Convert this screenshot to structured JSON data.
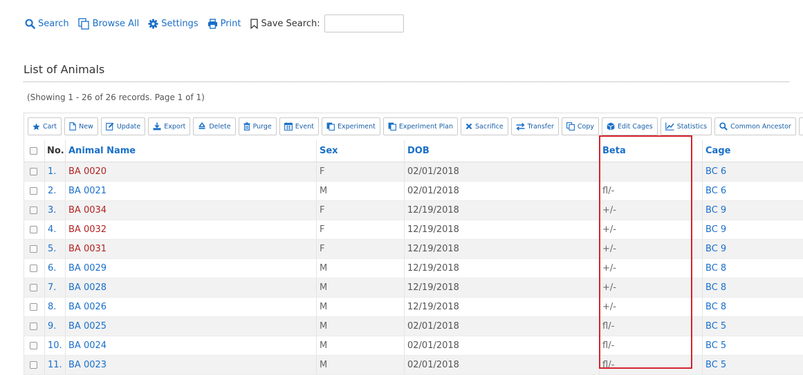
{
  "nav": {
    "search": "Search",
    "browse_all": "Browse All",
    "settings": "Settings",
    "print": "Print",
    "save_search": "Save Search:",
    "save_search_value": ""
  },
  "heading": "List of Animals",
  "showing": "(Showing 1 - 26 of 26 records. Page 1 of 1)",
  "toolbar": [
    {
      "label": "Cart",
      "icon": "star-icon"
    },
    {
      "label": "New",
      "icon": "file-icon"
    },
    {
      "label": "Update",
      "icon": "edit-icon"
    },
    {
      "label": "Export",
      "icon": "download-icon"
    },
    {
      "label": "Delete",
      "icon": "recycle-icon"
    },
    {
      "label": "Purge",
      "icon": "trash-icon"
    },
    {
      "label": "Event",
      "icon": "calendar-icon"
    },
    {
      "label": "Experiment",
      "icon": "clipboard-icon"
    },
    {
      "label": "Experiment Plan",
      "icon": "clipboard-icon"
    },
    {
      "label": "Sacrifice",
      "icon": "x-icon"
    },
    {
      "label": "Transfer",
      "icon": "transfer-icon"
    },
    {
      "label": "Copy",
      "icon": "copy-icon"
    },
    {
      "label": "Edit Cages",
      "icon": "cube-icon"
    },
    {
      "label": "Statistics",
      "icon": "chart-icon"
    },
    {
      "label": "Common Ancestor",
      "icon": "search-icon"
    },
    {
      "label": "",
      "icon": "scale-icon"
    }
  ],
  "columns": {
    "no": "No.",
    "name": "Animal Name",
    "sex": "Sex",
    "dob": "DOB",
    "beta": "Beta",
    "cage": "Cage"
  },
  "rows": [
    {
      "no": "1.",
      "name": "BA 0020",
      "sex": "F",
      "dob": "02/01/2018",
      "beta": "",
      "cage": "BC 6",
      "female": true
    },
    {
      "no": "2.",
      "name": "BA 0021",
      "sex": "M",
      "dob": "02/01/2018",
      "beta": "fl/-",
      "cage": "BC 6",
      "female": false
    },
    {
      "no": "3.",
      "name": "BA 0034",
      "sex": "F",
      "dob": "12/19/2018",
      "beta": "+/-",
      "cage": "BC 9",
      "female": true
    },
    {
      "no": "4.",
      "name": "BA 0032",
      "sex": "F",
      "dob": "12/19/2018",
      "beta": "+/-",
      "cage": "BC 9",
      "female": true
    },
    {
      "no": "5.",
      "name": "BA 0031",
      "sex": "F",
      "dob": "12/19/2018",
      "beta": "+/-",
      "cage": "BC 9",
      "female": true
    },
    {
      "no": "6.",
      "name": "BA 0029",
      "sex": "M",
      "dob": "12/19/2018",
      "beta": "+/-",
      "cage": "BC 8",
      "female": false
    },
    {
      "no": "7.",
      "name": "BA 0028",
      "sex": "M",
      "dob": "12/19/2018",
      "beta": "+/-",
      "cage": "BC 8",
      "female": false
    },
    {
      "no": "8.",
      "name": "BA 0026",
      "sex": "M",
      "dob": "12/19/2018",
      "beta": "+/-",
      "cage": "BC 8",
      "female": false
    },
    {
      "no": "9.",
      "name": "BA 0025",
      "sex": "M",
      "dob": "02/01/2018",
      "beta": "fl/-",
      "cage": "BC 5",
      "female": false
    },
    {
      "no": "10.",
      "name": "BA 0024",
      "sex": "M",
      "dob": "02/01/2018",
      "beta": "fl/-",
      "cage": "BC 5",
      "female": false
    },
    {
      "no": "11.",
      "name": "BA 0023",
      "sex": "M",
      "dob": "02/01/2018",
      "beta": "fl/-",
      "cage": "BC 5",
      "female": false
    }
  ],
  "colors": {
    "link": "#1a6fc9",
    "female_name": "#b22222",
    "highlight": "#d3232a"
  }
}
